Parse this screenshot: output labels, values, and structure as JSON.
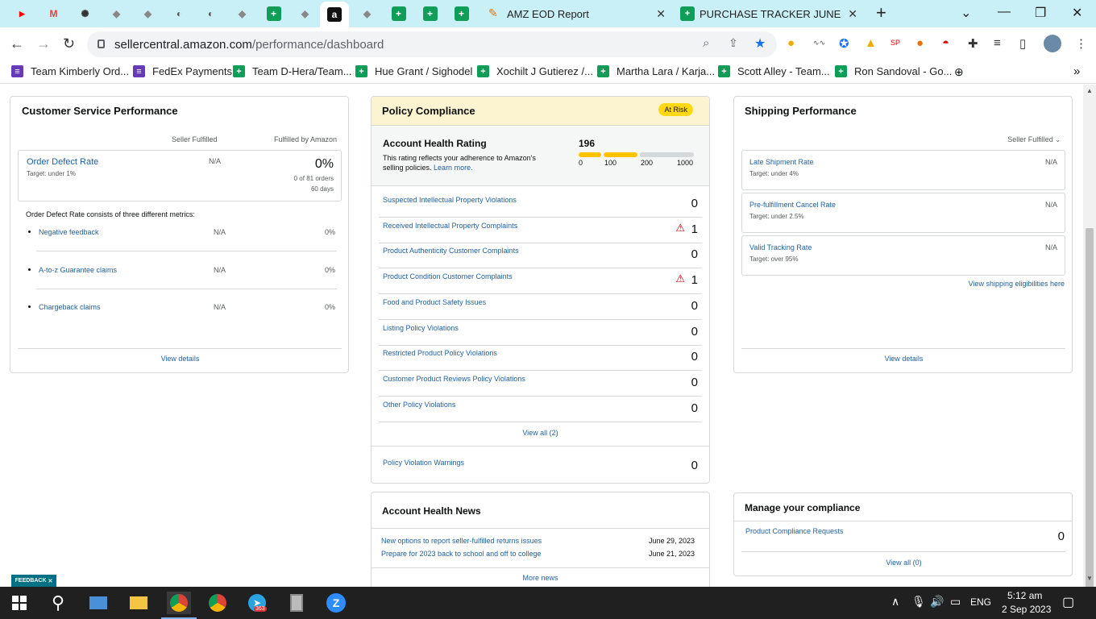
{
  "browser": {
    "tabs": [
      {
        "icon": "youtube-icon"
      },
      {
        "icon": "gmail-icon"
      },
      {
        "icon": "chatgpt-icon"
      },
      {
        "icon": "tab-icon"
      },
      {
        "icon": "tab-icon"
      },
      {
        "icon": "globe-icon"
      },
      {
        "icon": "globe-icon"
      },
      {
        "icon": "tab-icon"
      },
      {
        "icon": "sheets-icon"
      },
      {
        "icon": "tab-icon"
      },
      {
        "icon": "amazon-icon",
        "active": true
      },
      {
        "icon": "tab-icon"
      },
      {
        "icon": "sheets-icon"
      },
      {
        "icon": "sheets-icon"
      },
      {
        "icon": "sheets-icon"
      }
    ],
    "named_tabs": [
      {
        "title": "AMZ EOD Report",
        "icon": "pencil-icon"
      },
      {
        "title": "PURCHASE TRACKER JUNE - Goo",
        "icon": "sheets-icon"
      }
    ],
    "url_host": "sellercentral.amazon.com",
    "url_path": "/performance/dashboard",
    "bookmarks": [
      {
        "label": "Team Kimberly Ord...",
        "icon": "forms-icon",
        "color": "#673ab7"
      },
      {
        "label": "FedEx Payments",
        "icon": "forms-icon",
        "color": "#673ab7"
      },
      {
        "label": "Team D-Hera/Team...",
        "icon": "sheets-icon",
        "color": "#0f9d58"
      },
      {
        "label": "Hue Grant / Sighodel",
        "icon": "sheets-icon",
        "color": "#0f9d58"
      },
      {
        "label": "Xochilt J Gutierez /...",
        "icon": "sheets-icon",
        "color": "#0f9d58"
      },
      {
        "label": "Martha Lara / Karja...",
        "icon": "sheets-icon",
        "color": "#0f9d58"
      },
      {
        "label": "Scott Alley - Team...",
        "icon": "sheets-icon",
        "color": "#0f9d58"
      },
      {
        "label": "Ron Sandoval - Go...",
        "icon": "sheets-icon",
        "color": "#0f9d58"
      }
    ],
    "more_chevron": "»"
  },
  "csp": {
    "title": "Customer Service Performance",
    "col_seller": "Seller Fulfilled",
    "col_fba": "Fulfilled by Amazon",
    "odr_label": "Order Defect Rate",
    "odr_target": "Target: under 1%",
    "odr_seller": "N/A",
    "odr_fba": "0%",
    "odr_orders": "0 of 81 orders",
    "odr_days": "60 days",
    "consists": "Order Defect Rate consists of three different metrics:",
    "metrics": [
      {
        "label": "Negative feedback",
        "seller": "N/A",
        "fba": "0%"
      },
      {
        "label": "A-to-z Guarantee claims",
        "seller": "N/A",
        "fba": "0%"
      },
      {
        "label": "Chargeback claims",
        "seller": "N/A",
        "fba": "0%"
      }
    ],
    "view_details": "View details"
  },
  "policy": {
    "title": "Policy Compliance",
    "badge": "At Risk",
    "ahr_title": "Account Health Rating",
    "ahr_value": "196",
    "ahr_desc_1": "This rating reflects your adherence to Amazon's",
    "ahr_desc_2": "selling policies.",
    "learn_more": "Learn more.",
    "scale": [
      "0",
      "100",
      "200",
      "1000"
    ],
    "rating_level": 196,
    "items": [
      {
        "label": "Suspected Intellectual Property Violations",
        "count": "0",
        "warn": false
      },
      {
        "label": "Received Intellectual Property Complaints",
        "count": "1",
        "warn": true
      },
      {
        "label": "Product Authenticity Customer Complaints",
        "count": "0",
        "warn": false
      },
      {
        "label": "Product Condition Customer Complaints",
        "count": "1",
        "warn": true
      },
      {
        "label": "Food and Product Safety Issues",
        "count": "0",
        "warn": false
      },
      {
        "label": "Listing Policy Violations",
        "count": "0",
        "warn": false
      },
      {
        "label": "Restricted Product Policy Violations",
        "count": "0",
        "warn": false
      },
      {
        "label": "Customer Product Reviews Policy Violations",
        "count": "0",
        "warn": false
      },
      {
        "label": "Other Policy Violations",
        "count": "0",
        "warn": false
      }
    ],
    "view_all": "View all (2)",
    "warnings_label": "Policy Violation Warnings",
    "warnings_count": "0"
  },
  "news": {
    "title": "Account Health News",
    "items": [
      {
        "label": "New options to report seller-fulfilled returns issues",
        "date": "June 29, 2023"
      },
      {
        "label": "Prepare for 2023 back to school and off to college",
        "date": "June 21, 2023"
      }
    ],
    "more": "More news"
  },
  "shipping": {
    "title": "Shipping Performance",
    "dropdown": "Seller Fulfilled",
    "items": [
      {
        "label": "Late Shipment Rate",
        "target": "Target: under 4%",
        "value": "N/A"
      },
      {
        "label": "Pre-fulfillment Cancel Rate",
        "target": "Target: under 2.5%",
        "value": "N/A"
      },
      {
        "label": "Valid Tracking Rate",
        "target": "Target: over 95%",
        "value": "N/A"
      }
    ],
    "eligibility": "View shipping eligibilities here",
    "view_details": "View details"
  },
  "compliance": {
    "title": "Manage your compliance",
    "item_label": "Product Compliance Requests",
    "item_count": "0",
    "view_all": "View all (0)"
  },
  "feedback": "FEEDBACK",
  "feedback_close": "✕",
  "taskbar": {
    "lang": "ENG",
    "time": "5:12 am",
    "date": "2 Sep 2023",
    "telegram_badge": "363"
  },
  "colors": {
    "link": "#2162a1",
    "at_risk_bg": "#fcf3d0",
    "badge": "#ffd814",
    "bar_fill": "#ffc400",
    "bar_empty": "#d5d9d9",
    "tabbar": "#c9f0f7"
  }
}
